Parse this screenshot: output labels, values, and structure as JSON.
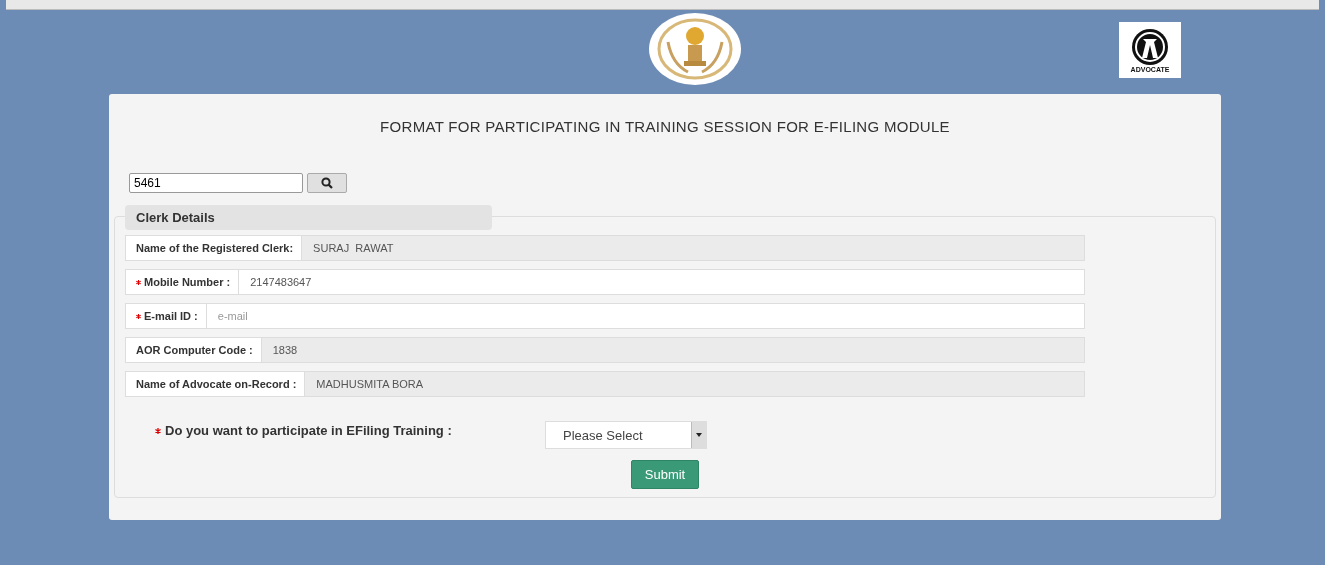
{
  "header": {
    "advocate_logo": {
      "caption": "ADVOCATE"
    }
  },
  "form": {
    "title": "FORMAT FOR PARTICIPATING IN TRAINING SESSION FOR E-FILING MODULE",
    "search": {
      "value": "5461"
    },
    "section": {
      "legend": "Clerk Details",
      "fields": [
        {
          "label": "Name of the Registered Clerk:",
          "kind": "readonly",
          "required": false,
          "value": "SURAJ  RAWAT"
        },
        {
          "label": "Mobile Number :",
          "kind": "input",
          "required": true,
          "value": "2147483647"
        },
        {
          "label": "E-mail ID :",
          "kind": "input",
          "required": true,
          "placeholder": "e-mail"
        },
        {
          "label": "AOR Computer Code :",
          "kind": "readonly",
          "required": false,
          "value": "1838"
        },
        {
          "label": "Name of Advocate on-Record :",
          "kind": "readonly",
          "required": false,
          "value": "MADHUSMITA BORA"
        }
      ],
      "question": {
        "label": "Do you want to participate in EFiling Training :",
        "required": true,
        "value": "Please Select"
      },
      "submit": "Submit"
    }
  }
}
